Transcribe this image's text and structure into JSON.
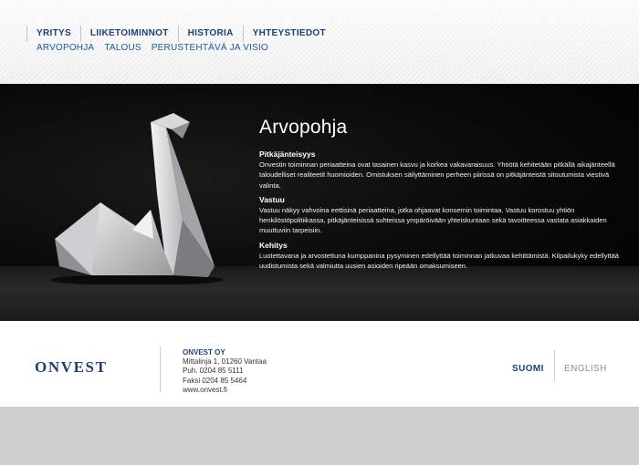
{
  "nav": {
    "main": [
      {
        "label": "YRITYS"
      },
      {
        "label": "LIIKETOIMINNOT"
      },
      {
        "label": "HISTORIA"
      },
      {
        "label": "YHTEYSTIEDOT"
      }
    ],
    "sub": [
      {
        "label": "ARVOPOHJA"
      },
      {
        "label": "TALOUS"
      },
      {
        "label": "PERUSTEHTÄVÄ JA VISIO"
      }
    ]
  },
  "content": {
    "title": "Arvopohja",
    "sections": [
      {
        "heading": "Pitkäjänteisyys",
        "text": "Onvestin toiminnan periaatteina ovat tasainen kasvu ja korkea vakavaraisuus. Yhtiötä kehitetään pitkällä aikajänteellä taloudelliset realiteetit huomioiden. Omistuksen säilyttäminen perheen piirissä on pitkäjänteistä sitoutumista viestivä valinta."
      },
      {
        "heading": "Vastuu",
        "text": "Vastuu näkyy vahvoina eettisinä periaatteina, jotka ohjaavat konsernin toimintaa. Vastuu korostuu yhtiön henkilöstöpolitiikassa, pitkäjänteisissä suhteissa ympäröivään yhteiskuntaan sekä tavoitteessa vastata asiakkaiden muuttuviin tarpeisiin."
      },
      {
        "heading": "Kehitys",
        "text": "Luotettavana ja arvostettuna kumppanina pysyminen edellyttää toiminnan jatkuvaa kehittämistä. Kilpailukyky edellyttää uudistumista sekä valmiutta uusien asioiden ripeään omaksumiseen."
      }
    ]
  },
  "footer": {
    "logo_text": "ONVEST",
    "company": "ONVEST OY",
    "address": "Mittalinja 1, 01260 Vantaa",
    "phone": "Puh. 0204 85 5111",
    "fax": "Faksi 0204 85 5464",
    "web": "www.onvest.fi",
    "lang_fi": "SUOMI",
    "lang_en": "ENGLISH"
  },
  "colors": {
    "brand_blue": "#1d3f7a",
    "link_blue": "#1d5a96",
    "hero_bg": "#000000",
    "page_bg": "#cfcfcf"
  },
  "icons": {
    "hero_image": "origami-swan-illustration"
  }
}
